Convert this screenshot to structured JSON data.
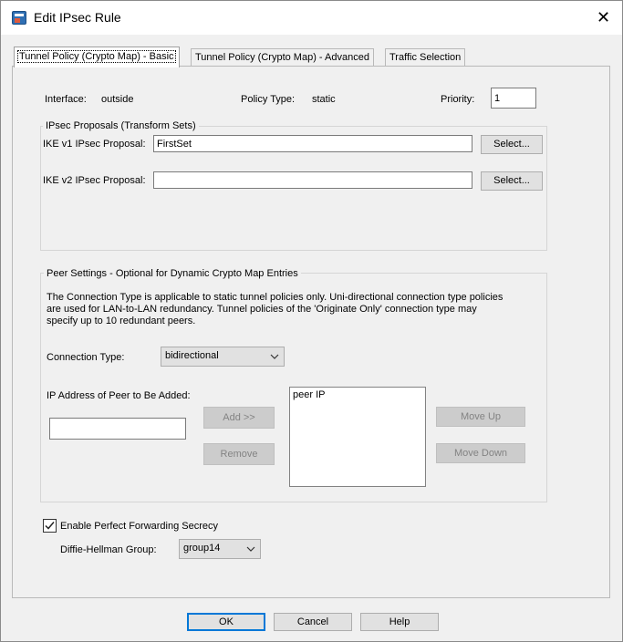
{
  "window": {
    "title": "Edit IPsec Rule",
    "close_glyph": "✕"
  },
  "tabs": [
    {
      "label": "Tunnel Policy (Crypto Map) - Basic",
      "active": true
    },
    {
      "label": "Tunnel Policy (Crypto Map) - Advanced",
      "active": false
    },
    {
      "label": "Traffic Selection",
      "active": false
    }
  ],
  "policy": {
    "interface_label": "Interface:",
    "interface_value": "outside",
    "policy_type_label": "Policy Type:",
    "policy_type_value": "static",
    "priority_label": "Priority:",
    "priority_value": "1"
  },
  "proposals": {
    "legend": "IPsec Proposals (Transform Sets)",
    "ikev1_label": "IKE v1 IPsec Proposal:",
    "ikev1_value": "FirstSet",
    "ikev1_select": "Select...",
    "ikev2_label": "IKE v2 IPsec Proposal:",
    "ikev2_value": "",
    "ikev2_select": "Select..."
  },
  "peer": {
    "legend": "Peer Settings  -  Optional for Dynamic Crypto Map Entries",
    "description_line1": "The Connection Type is applicable to static tunnel policies only. Uni-directional connection type policies",
    "description_line2": "are used for LAN-to-LAN redundancy. Tunnel policies of the 'Originate Only' connection type may",
    "description_line3": "specify up to 10 redundant peers.",
    "connection_type_label": "Connection Type:",
    "connection_type_value": "bidirectional",
    "ip_address_label": "IP Address of Peer to Be Added:",
    "ip_address_value": "",
    "add_button": "Add >>",
    "remove_button": "Remove",
    "peer_list": [
      "peer IP"
    ],
    "move_up_button": "Move Up",
    "move_down_button": "Move Down"
  },
  "pfs": {
    "checkbox_label": "Enable Perfect Forwarding Secrecy",
    "checked": true,
    "dh_group_label": "Diffie-Hellman Group:",
    "dh_group_value": "group14"
  },
  "footer": {
    "ok_label": "OK",
    "cancel_label": "Cancel",
    "help_label": "Help"
  },
  "icons": {
    "app": "app-icon",
    "close": "close-icon",
    "dropdown": "chevron-down-icon",
    "check": "checkmark-icon"
  }
}
